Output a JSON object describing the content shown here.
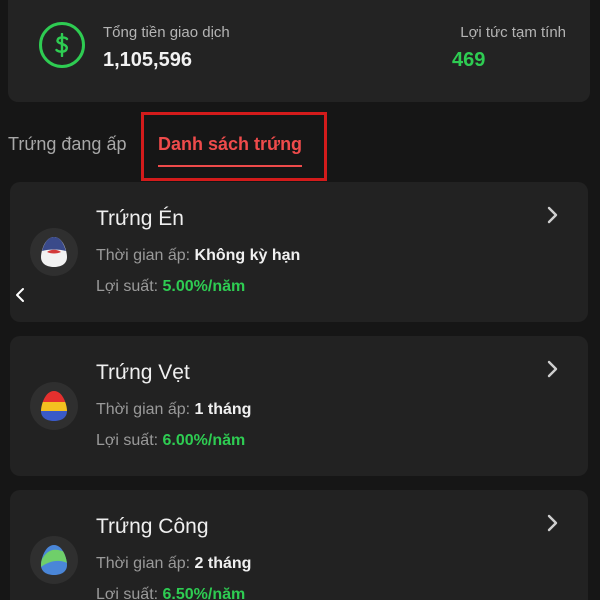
{
  "summary": {
    "total_label": "Tổng tiền giao dịch",
    "total_value": "1,105,596",
    "profit_label": "Lợi tức tạm tính",
    "profit_value": "469",
    "icon": "dollar-circle-icon"
  },
  "tabs": [
    {
      "label": "Trứng đang ấp",
      "active": false
    },
    {
      "label": "Danh sách trứng",
      "active": true
    }
  ],
  "eggs": [
    {
      "name": "Trứng Én",
      "time_label": "Thời gian ấp: ",
      "time_value": "Không kỳ hạn",
      "rate_label": "Lợi suất: ",
      "rate_value": "5.00%/năm"
    },
    {
      "name": "Trứng Vẹt",
      "time_label": "Thời gian ấp: ",
      "time_value": "1 tháng",
      "rate_label": "Lợi suất: ",
      "rate_value": "6.00%/năm"
    },
    {
      "name": "Trứng Công",
      "time_label": "Thời gian ấp: ",
      "time_value": "2 tháng",
      "rate_label": "Lợi suất: ",
      "rate_value": "6.50%/năm"
    }
  ],
  "colors": {
    "accent_green": "#2ecc52",
    "accent_red": "#ef4b4b",
    "highlight_red": "#d31b1b",
    "background": "#161616",
    "card": "#222222"
  }
}
